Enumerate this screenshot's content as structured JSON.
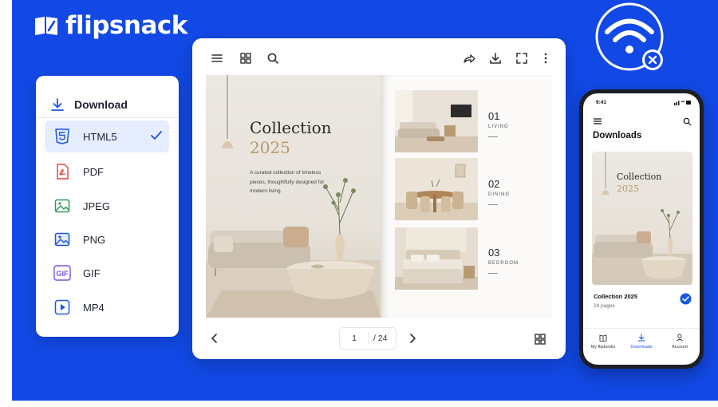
{
  "brand": {
    "name": "flipsnack",
    "accent": "#1249e6"
  },
  "download_panel": {
    "title": "Download",
    "formats": [
      {
        "label": "HTML5",
        "icon": "html5-icon",
        "selected": true
      },
      {
        "label": "PDF",
        "icon": "pdf-icon",
        "selected": false
      },
      {
        "label": "JPEG",
        "icon": "image-icon",
        "selected": false
      },
      {
        "label": "PNG",
        "icon": "image-icon",
        "selected": false
      },
      {
        "label": "GIF",
        "icon": "gif-icon",
        "selected": false
      },
      {
        "label": "MP4",
        "icon": "video-icon",
        "selected": false
      }
    ]
  },
  "reader": {
    "toolbar_left": [
      "menu-icon",
      "grid-icon",
      "search-icon"
    ],
    "toolbar_right": [
      "share-icon",
      "download-icon",
      "fullscreen-icon",
      "more-icon"
    ],
    "book": {
      "title": "Collection",
      "year": "2025",
      "description": "A curated collection of timeless pieces, thoughtfully designed for modern living.",
      "rooms": [
        {
          "number": "01",
          "label": "LIVING"
        },
        {
          "number": "02",
          "label": "DINING"
        },
        {
          "number": "03",
          "label": "BEDROOM"
        }
      ]
    },
    "pager": {
      "current": "1",
      "total": "/ 24"
    }
  },
  "phone": {
    "time": "9:41",
    "title": "Downloads",
    "card_title": "Collection",
    "card_year": "2025",
    "item_name": "Collection 2025",
    "item_pages": "24 pages",
    "nav": [
      {
        "label": "My flipbooks",
        "icon": "book-icon",
        "active": false
      },
      {
        "label": "Downloads",
        "icon": "download-icon",
        "active": true
      },
      {
        "label": "Account",
        "icon": "user-icon",
        "active": false
      }
    ]
  }
}
